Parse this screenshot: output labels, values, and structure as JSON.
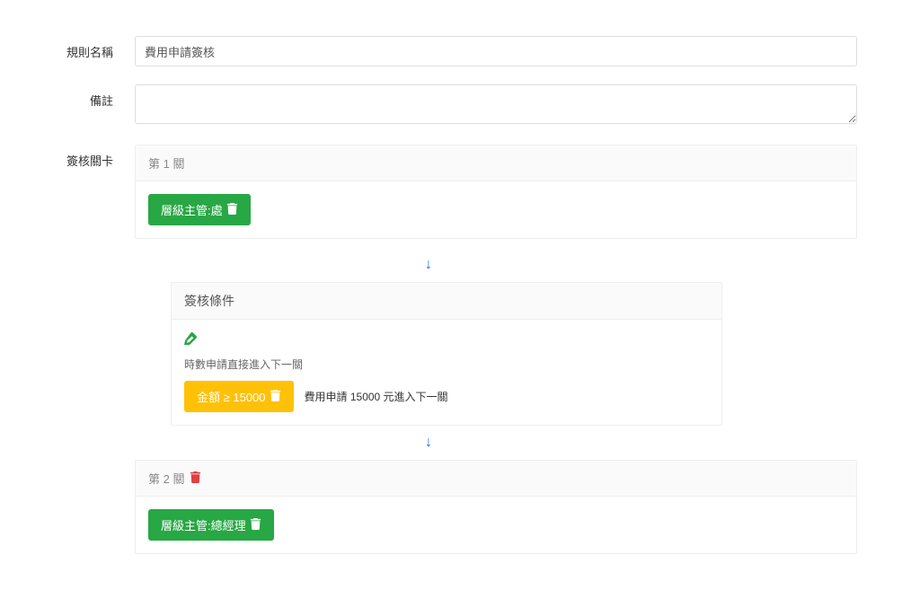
{
  "labels": {
    "rule_name": "規則名稱",
    "remark": "備註",
    "approval_levels": "簽核關卡"
  },
  "fields": {
    "rule_name_value": "費用申請簽核",
    "remark_value": ""
  },
  "level1": {
    "title": "第 1 關",
    "approver_button": "層級主管:處"
  },
  "condition": {
    "title": "簽核條件",
    "note": "時數申請直接進入下一關",
    "badge": "金額 ≥ 15000",
    "description": "費用申請 15000 元進入下一關"
  },
  "level2": {
    "title": "第 2 關",
    "approver_button": "層級主管:總經理"
  }
}
